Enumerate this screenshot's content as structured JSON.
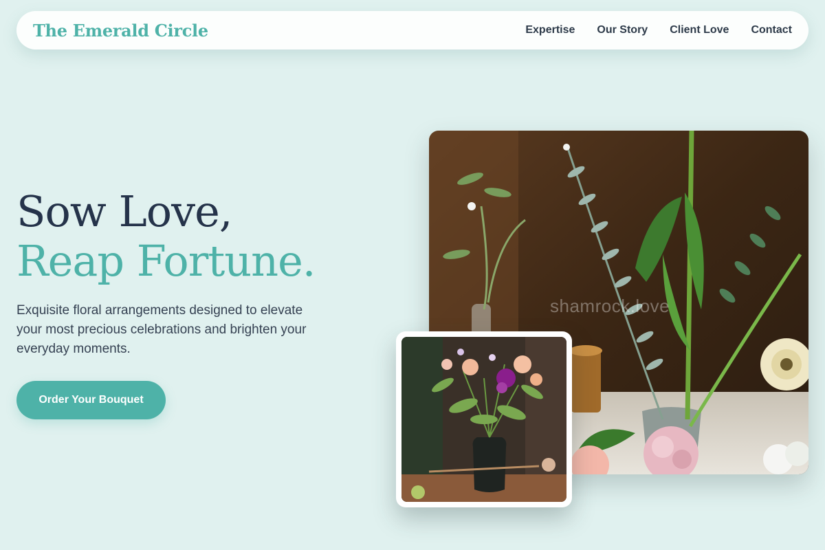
{
  "brand": "The Emerald Circle",
  "nav": [
    "Expertise",
    "Our Story",
    "Client Love",
    "Contact"
  ],
  "hero": {
    "title_line1": "Sow Love,",
    "title_line2": "Reap Fortune.",
    "subtitle": "Exquisite floral arrangements designed to elevate your most precious celebrations and brighten your everyday moments.",
    "cta": "Order Your Bouquet"
  },
  "images": {
    "main": {
      "watermark": "shamrock.love"
    }
  },
  "colors": {
    "background": "#e0f1ef",
    "accent": "#4eb2a8",
    "heading": "#25334a",
    "nav_bg": "#ffffff"
  }
}
